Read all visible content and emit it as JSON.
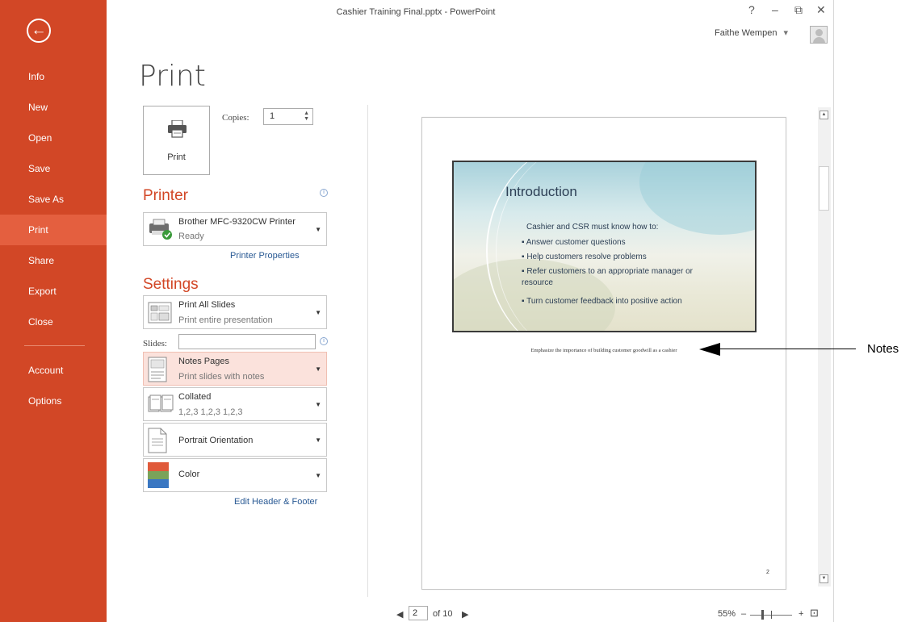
{
  "window": {
    "title": "Cashier Training Final.pptx - PowerPoint",
    "help_label": "?",
    "minimize_label": "–",
    "restore_label": "⧉",
    "close_label": "✕",
    "user_name": "Faithe Wempen",
    "user_dropdown": "▾"
  },
  "sidebar": {
    "back_label": "←",
    "items": [
      {
        "label": "Info"
      },
      {
        "label": "New"
      },
      {
        "label": "Open"
      },
      {
        "label": "Save"
      },
      {
        "label": "Save As"
      },
      {
        "label": "Print"
      },
      {
        "label": "Share"
      },
      {
        "label": "Export"
      },
      {
        "label": "Close"
      },
      {
        "label": "Account"
      },
      {
        "label": "Options"
      }
    ],
    "active": "Print"
  },
  "print": {
    "heading": "Print",
    "button_label": "Print",
    "copies_label": "Copies:",
    "copies_value": "1"
  },
  "printer": {
    "heading": "Printer",
    "name": "Brother MFC-9320CW Printer",
    "status": "Ready",
    "properties_link": "Printer Properties"
  },
  "settings": {
    "heading": "Settings",
    "what": {
      "title": "Print All Slides",
      "subtitle": "Print entire presentation"
    },
    "slides_label": "Slides:",
    "slides_value": "",
    "layout": {
      "title": "Notes Pages",
      "subtitle": "Print slides with notes"
    },
    "collation": {
      "title": "Collated",
      "subtitle": "1,2,3   1,2,3   1,2,3"
    },
    "orientation": {
      "title": "Portrait Orientation"
    },
    "color": {
      "title": "Color"
    },
    "header_footer_link": "Edit Header & Footer"
  },
  "preview": {
    "slide_title": "Introduction",
    "slide_subtitle": "Cashier and CSR must know how to:",
    "bullets": [
      "Answer customer questions",
      "Help customers resolve problems",
      "Refer customers to an appropriate manager or resource",
      "Turn customer feedback into positive action"
    ],
    "notes_text": "Emphasize the importance of building customer goodwill as a cashier",
    "page_number": "2"
  },
  "pager": {
    "prev_label": "◀",
    "current_page": "2",
    "of_label": "of 10",
    "next_label": "▶"
  },
  "zoom": {
    "level": "55%",
    "minus": "–",
    "plus": "+",
    "fit_label": "⊡"
  },
  "annotation": {
    "label": "Notes"
  },
  "colors": {
    "accent": "#d24726",
    "active_nav": "#e45f3f",
    "highlight": "#fbe2dc",
    "link": "#2a5a94"
  }
}
